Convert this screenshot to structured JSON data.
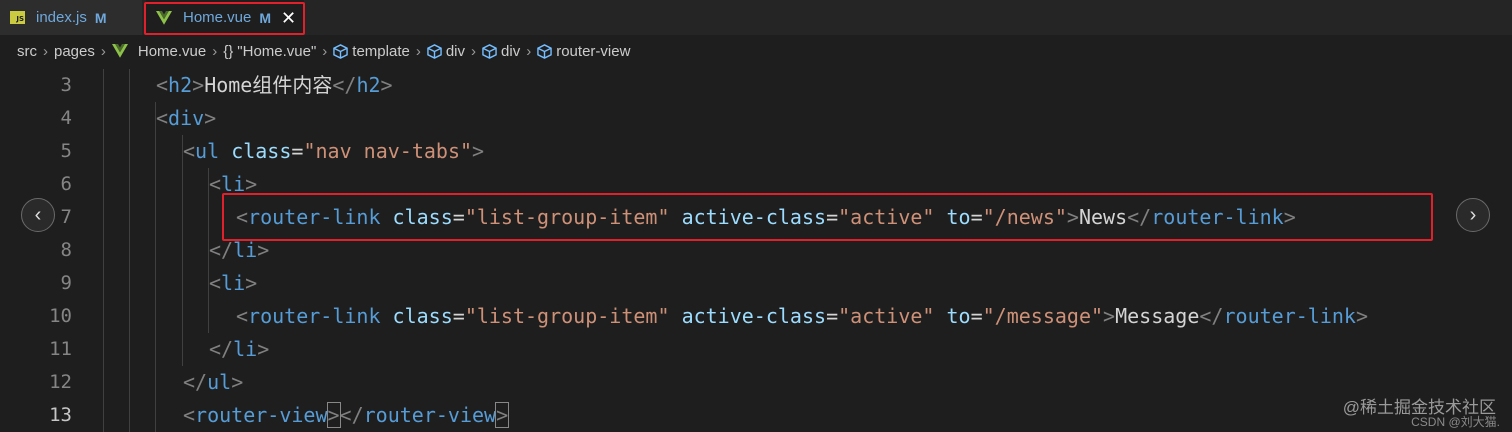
{
  "tabs": [
    {
      "label": "index.js",
      "modified": "M",
      "icon": "js-file-icon"
    },
    {
      "label": "Home.vue",
      "modified": "M",
      "icon": "vue-file-icon",
      "close": "✕"
    }
  ],
  "js_icon_text": "JS",
  "breadcrumb": {
    "src": "src",
    "pages": "pages",
    "file": "Home.vue",
    "braces": "{}",
    "obj": "\"Home.vue\"",
    "template": "template",
    "div1": "div",
    "div2": "div",
    "router_view": "router-view"
  },
  "line_numbers": [
    "3",
    "4",
    "5",
    "6",
    "7",
    "8",
    "9",
    "10",
    "11",
    "12",
    "13"
  ],
  "code": {
    "l3": {
      "open": "<",
      "tag": "h2",
      "close": ">",
      "text": "Home组件内容",
      "open2": "</",
      "tag2": "h2",
      "close2": ">"
    },
    "l4": {
      "open": "<",
      "tag": "div",
      "close": ">"
    },
    "l5": {
      "open": "<",
      "tag": "ul",
      "sp": " ",
      "attr": "class",
      "eq": "=",
      "val": "\"nav nav-tabs\"",
      "close": ">"
    },
    "l6": {
      "open": "<",
      "tag": "li",
      "close": ">"
    },
    "l7": {
      "open": "<",
      "tag": "router-link",
      "a1": "class",
      "v1": "\"list-group-item\"",
      "a2": "active-class",
      "v2": "\"active\"",
      "a3": "to",
      "v3": "\"/news\"",
      "close": ">",
      "text": "News",
      "open2": "</",
      "tag2": "router-link",
      "close2": ">"
    },
    "l8": {
      "open": "</",
      "tag": "li",
      "close": ">"
    },
    "l9": {
      "open": "<",
      "tag": "li",
      "close": ">"
    },
    "l10": {
      "open": "<",
      "tag": "router-link",
      "a1": "class",
      "v1": "\"list-group-item\"",
      "a2": "active-class",
      "v2": "\"active\"",
      "a3": "to",
      "v3": "\"/message\"",
      "close": ">",
      "text": "Message",
      "open2": "</",
      "tag2": "router-link",
      "close2": ">"
    },
    "l11": {
      "open": "</",
      "tag": "li",
      "close": ">"
    },
    "l12": {
      "open": "</",
      "tag": "ul",
      "close": ">"
    },
    "l13": {
      "open": "<",
      "tag": "router-view",
      "close": ">",
      "open2": "</",
      "tag2": "router-view",
      "close2": ">"
    }
  },
  "nav": {
    "prev": "‹",
    "next": "›"
  },
  "watermark": "@稀土掘金技术社区",
  "watermark2": "CSDN @刘大猫.",
  "colors": {
    "tag": "#569cd6",
    "attr": "#9cdcfe",
    "string": "#ce9178",
    "highlight": "#e0202a"
  }
}
